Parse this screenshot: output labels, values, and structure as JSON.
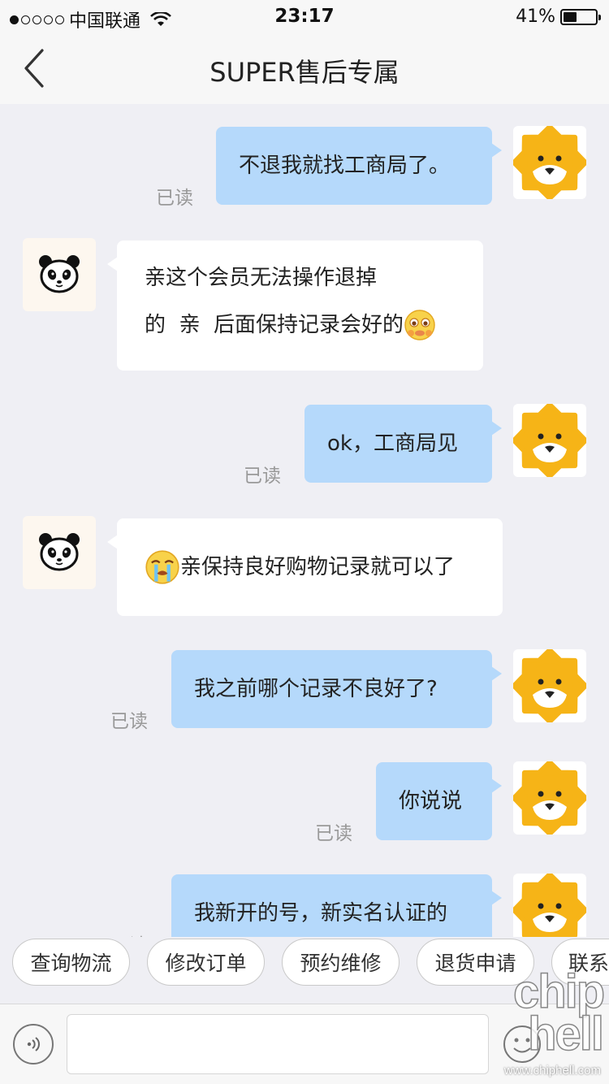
{
  "status_bar": {
    "carrier": "中国联通",
    "time": "23:17",
    "battery_percent": "41%",
    "battery_level": 0.41,
    "signal_dots": 1
  },
  "nav": {
    "title": "SUPER售后专属"
  },
  "messages": [
    {
      "side": "out",
      "lines": [
        "不退我就找工商局了。"
      ],
      "read": "已读"
    },
    {
      "side": "in",
      "lines": [
        "亲这个会员无法操作退掉",
        "的  亲  后面保持记录会好的"
      ],
      "emoji": "pleading-face"
    },
    {
      "side": "out",
      "lines": [
        "ok，工商局见"
      ],
      "read": "已读"
    },
    {
      "side": "in",
      "lines": [
        "亲保持良好购物记录就可以了"
      ],
      "emoji": "crying-face"
    },
    {
      "side": "out",
      "lines": [
        "我之前哪个记录不良好了?"
      ],
      "read": "已读"
    },
    {
      "side": "out",
      "lines": [
        "你说说"
      ],
      "read": "已读"
    },
    {
      "side": "out",
      "lines": [
        "我新开的号，新实名认证的"
      ],
      "read": "已读"
    }
  ],
  "quick_replies": [
    "查询物流",
    "修改订单",
    "预约维修",
    "退货申请",
    "联系"
  ],
  "input": {
    "value": ""
  },
  "watermark": {
    "logo": "chip hell",
    "url": "www.chiphell.com"
  },
  "colors": {
    "outgoing_bubble": "#b5d9fb",
    "incoming_bubble": "#ffffff",
    "background": "#efeff4",
    "lion_orange": "#f6b417"
  }
}
